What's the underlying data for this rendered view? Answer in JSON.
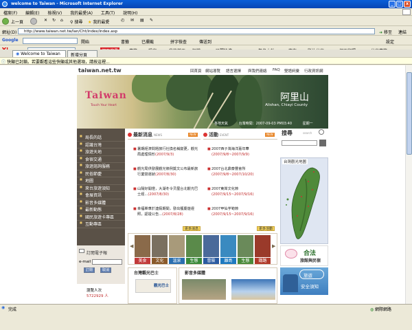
{
  "window": {
    "title": "welcome to Taiwan - Microsoft Internet Explorer",
    "controls": [
      "_",
      "□",
      "x"
    ]
  },
  "menu": [
    "檔案(F)",
    "編輯(E)",
    "檢視(V)",
    "我的最愛(A)",
    "工具(T)",
    "說明(H)"
  ],
  "toolbar": {
    "back": "上一頁",
    "search": "搜尋",
    "favorites": "我的最愛"
  },
  "address": {
    "label": "網址(D)",
    "url": "http://www.taiwan.net.tw/lan/Cht/index/index.asp",
    "go": "移至",
    "links": "連結"
  },
  "google_bar": {
    "label": "Google",
    "go": "開始",
    "items": [
      "書籤",
      "已攔截",
      "拼字檢查",
      "傳送到",
      "設定"
    ]
  },
  "yahoo_bar": {
    "label": "Y!",
    "items": [
      "網頁搜尋",
      "書籤",
      "設定",
      "我的首頁",
      "知識+",
      "民間論壇",
      "無名小站",
      "交友",
      "影片分享",
      "網頁翻譯",
      "分享書籤"
    ]
  },
  "tabs": [
    {
      "label": "Welcome to Taiwan"
    },
    {
      "label": "新增分頁"
    }
  ],
  "infobar": "快顯已封鎖。若要觀看這些快顯或其他選項，請按這裡...",
  "site": {
    "logo": "taiwan.net.tw",
    "topnav": [
      "回首頁",
      "網站導覽",
      "語言選擇",
      "與我們連絡",
      "FAQ",
      "雙語詞彙",
      "行政資訊網"
    ],
    "banner": {
      "title": "阿里山",
      "subtitle": "Alishan, Chiayi County",
      "brand": "Taiwan",
      "slogan": "Touch Your Heart",
      "info_left": "各地天氣",
      "info_time": "台灣時間：2007-09-03 PM03:40",
      "info_day": "星期一"
    },
    "leftnav": [
      "局長的話",
      "認識台灣",
      "旅遊天地",
      "食宿交通",
      "旅遊諮詢服務",
      "民俗節慶",
      "地圖",
      "來台旅遊須知",
      "會展資訊",
      "影音多媒體",
      "最新動態",
      "國民旅遊卡專區",
      "互動專區"
    ],
    "epaper": {
      "title": "訂閱電子報",
      "email_label": "e-mail",
      "subscribe": "訂閱",
      "cancel": "取消"
    },
    "visitors": {
      "label": "瀏覽人次",
      "count": "5722929 人"
    },
    "news": {
      "title": "最新消息",
      "en": "NEWS",
      "tag": "NEW",
      "more": "更多消息",
      "items": [
        {
          "text": "暑期經濟問題旅行社換名稱變更，觀光局處理情形",
          "date": "(2007/9/3)"
        },
        {
          "text": "觀光局供發展觀光條例獎文公布最新旅行業營運狀",
          "date": "(2007/8/30)"
        },
        {
          "text": "山陽好開燈，大湖冬令灵屋台北觀光巴士經...",
          "date": "(2007/8/30)"
        },
        {
          "text": "幸福單車於連假期間，發出獲慶遊證照，認證公告...",
          "date": "(2007/8/28)"
        }
      ]
    },
    "events": {
      "title": "活動",
      "en": "EVENT",
      "tag": "NEW",
      "more": "更多活動",
      "items": [
        {
          "text": "2007西子灣海洋嘉年華",
          "date": "(2007/9/8~2007/9/9)"
        },
        {
          "text": "2007台北鼎泰豐會所",
          "date": "(2007/9/8~2007/10/20)"
        },
        {
          "text": "2007東岸文化節",
          "date": "(2007/9/15~2007/9/16)"
        },
        {
          "text": "2007甲仙芋筍節",
          "date": "(2007/9/15~2007/9/16)"
        }
      ]
    },
    "categories": [
      "美食",
      "文化",
      "溫泉",
      "生態",
      "冒險",
      "離島",
      "生態",
      "鐵路"
    ],
    "search": {
      "title": "搜尋",
      "en": "search"
    },
    "map": {
      "title": "台灣觀光地圖"
    },
    "hotel_ad": {
      "t1": "合法",
      "t2": "旅館與民宿"
    },
    "safety_ad": {
      "t1": "旅遊",
      "t2": "安全須知"
    },
    "bus": {
      "title": "台灣觀光巴士",
      "caption": "觀光巴士"
    },
    "media": {
      "title": "影音多媒體"
    }
  },
  "status": {
    "text": "完成",
    "zone": "網際網路"
  },
  "colors": {
    "titlebar": "#0a5fd8",
    "leftnav": "#5a5147",
    "date_red": "#c12a2a",
    "accent_orange": "#e8882c"
  }
}
